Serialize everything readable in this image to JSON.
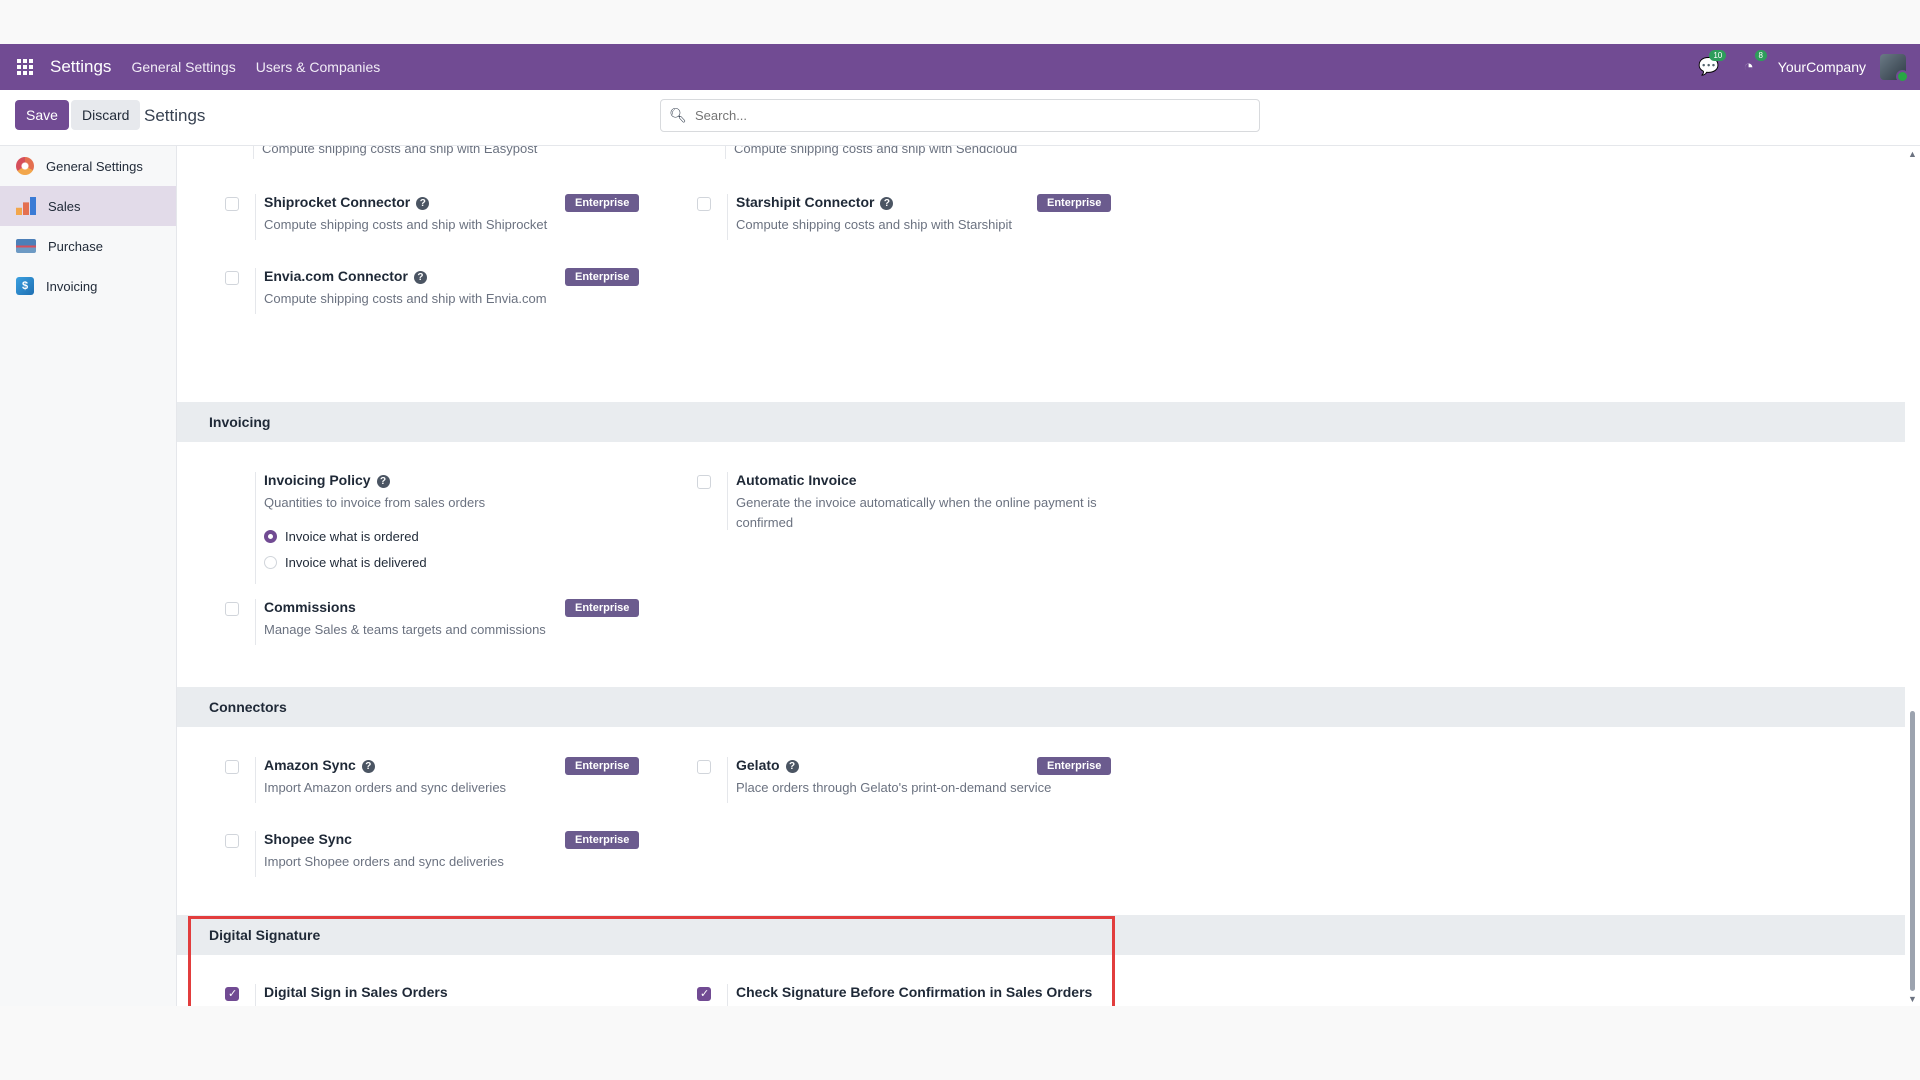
{
  "navbar": {
    "brand": "Settings",
    "links": [
      "General Settings",
      "Users & Companies"
    ],
    "messages_count": "10",
    "activities_count": "8",
    "company": "YourCompany"
  },
  "control": {
    "save_label": "Save",
    "discard_label": "Discard",
    "title": "Settings",
    "search_placeholder": "Search..."
  },
  "sidebar": {
    "items": [
      {
        "label": "General Settings",
        "icon": "gear-logo-icon"
      },
      {
        "label": "Sales",
        "icon": "sales-chart-icon"
      },
      {
        "label": "Purchase",
        "icon": "purchase-icon"
      },
      {
        "label": "Invoicing",
        "icon": "invoicing-icon"
      }
    ]
  },
  "top_partial": {
    "left_desc": "Compute shipping costs and ship with Easypost",
    "right_desc": "Compute shipping costs and ship with Sendcloud"
  },
  "shipping": [
    {
      "title": "Shiprocket Connector",
      "desc": "Compute shipping costs and ship with Shiprocket",
      "badge": "Enterprise"
    },
    {
      "title": "Starshipit Connector",
      "desc": "Compute shipping costs and ship with Starshipit",
      "badge": "Enterprise"
    },
    {
      "title": "Envia.com Connector",
      "desc": "Compute shipping costs and ship with Envia.com",
      "badge": "Enterprise"
    }
  ],
  "invoicing": {
    "heading": "Invoicing",
    "policy_title": "Invoicing Policy",
    "policy_desc": "Quantities to invoice from sales orders",
    "options": [
      "Invoice what is ordered",
      "Invoice what is delivered"
    ],
    "selected_option": "Invoice what is ordered",
    "auto_title": "Automatic Invoice",
    "auto_desc": "Generate the invoice automatically when the online payment is confirmed",
    "commissions_title": "Commissions",
    "commissions_desc": "Manage Sales & teams targets and commissions",
    "commissions_badge": "Enterprise"
  },
  "connectors": {
    "heading": "Connectors",
    "items": [
      {
        "title": "Amazon Sync",
        "desc": "Import Amazon orders and sync deliveries",
        "badge": "Enterprise"
      },
      {
        "title": "Gelato",
        "desc": "Place orders through Gelato's print-on-demand service",
        "badge": "Enterprise"
      },
      {
        "title": "Shopee Sync",
        "desc": "Import Shopee orders and sync deliveries",
        "badge": "Enterprise"
      }
    ]
  },
  "digital_signature": {
    "heading": "Digital Signature",
    "items": [
      {
        "title": "Digital Sign in Sales Orders",
        "checked": true
      },
      {
        "title": "Check Signature Before Confirmation in Sales Orders",
        "checked": true
      }
    ]
  },
  "colors": {
    "brand": "#714b93",
    "highlight": "#e23d3d",
    "enterprise_badge": "#6b5b8e"
  }
}
